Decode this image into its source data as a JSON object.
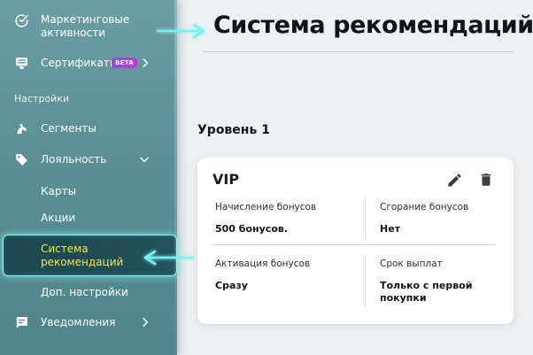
{
  "sidebar": {
    "items": [
      {
        "label_line1": "Маркетинговые",
        "label_line2": "активности",
        "icon": "check-circle-icon"
      },
      {
        "label": "Сертификаты",
        "badge": "BETA",
        "icon": "monitor-icon"
      }
    ],
    "section_title": "Настройки",
    "settings_items": [
      {
        "label": "Сегменты",
        "icon": "segments-icon"
      },
      {
        "label": "Лояльность",
        "icon": "tag-icon"
      }
    ],
    "loyalty_subitems": [
      "Карты",
      "Акции"
    ],
    "active_item": {
      "line1": "Система",
      "line2": "рекомендаций"
    },
    "extra_item": "Доп. настройки",
    "notifications": {
      "label": "Уведомления",
      "icon": "message-icon"
    }
  },
  "main": {
    "title": "Система рекомендаций",
    "level_title": "Уровень 1",
    "card": {
      "title": "VIP",
      "fields": [
        {
          "label": "Начисление бонусов",
          "value": "500 бонусов."
        },
        {
          "label": "Сгорание бонусов",
          "value": "Нет"
        },
        {
          "label": "Активация бонусов",
          "value": "Сразу"
        },
        {
          "label": "Срок выплат",
          "value_line1": "Только с первой",
          "value_line2": "покупки"
        }
      ]
    }
  },
  "colors": {
    "sidebar": "#5b8f95",
    "active_glow": "#8ef3f4",
    "active_text": "#f2ea3a",
    "beta_badge": "#a042df",
    "arrow": "#7af0f0"
  }
}
